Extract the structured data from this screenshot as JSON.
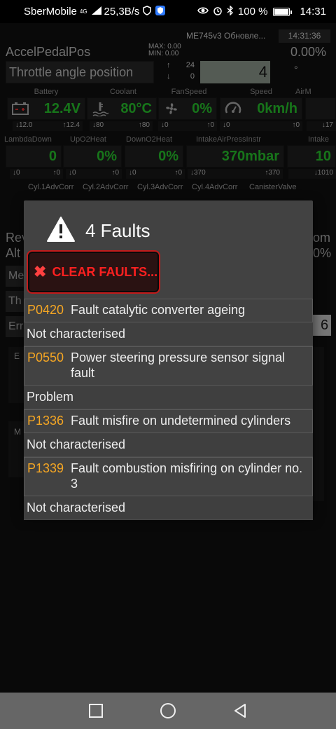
{
  "status_bar": {
    "carrier": "SberMobile",
    "network": "4G",
    "speed": "25,3B/s",
    "battery": "100 %",
    "time": "14:31"
  },
  "app": {
    "title_left": "ME745v3 Обновле...",
    "title_time": "14:31:36",
    "param_name": "AccelPedalPos",
    "max_label": "MAX: 0.00",
    "min_label": "MIN: 0.00",
    "param_value": "0.00%",
    "throttle_label": "Throttle angle position",
    "throttle_up": "24",
    "throttle_down": "0",
    "throttle_value": "4",
    "throttle_unit": "°",
    "throttle_up_arrow": "↑",
    "throttle_down_arrow": "↓"
  },
  "gauges_row1": [
    {
      "label": "Battery",
      "value": "12.4V",
      "icon": "battery-icon",
      "min": "↓12.0",
      "max": "↑12.4"
    },
    {
      "label": "Coolant",
      "value": "80°C",
      "icon": "thermometer-icon",
      "min": "↓80",
      "max": "↑80"
    },
    {
      "label": "FanSpeed",
      "value": "0%",
      "icon": "fan-icon",
      "min": "↓0",
      "max": "↑0"
    },
    {
      "label": "Speed",
      "value": "0km/h",
      "icon": "speedometer-icon",
      "min": "↓0",
      "max": "↑0"
    },
    {
      "label": "AirM",
      "value": "",
      "icon": "",
      "min": "↓17",
      "max": ""
    }
  ],
  "gauges_row2": [
    {
      "label": "LambdaDown",
      "value": "0",
      "min": "↓0",
      "max": "↑0"
    },
    {
      "label": "UpO2Heat",
      "value": "0%",
      "min": "↓0",
      "max": "↑0"
    },
    {
      "label": "DownO2Heat",
      "value": "0%",
      "min": "↓0",
      "max": "↑0"
    },
    {
      "label": "IntakeAirPressInstr",
      "value": "370mbar",
      "min": "↓370",
      "max": "↑370"
    },
    {
      "label": "Intake",
      "value": "10",
      "min": "↓1010",
      "max": ""
    }
  ],
  "gauges_row3": [
    {
      "label": "Cyl.1AdvCorr"
    },
    {
      "label": "Cyl.2AdvCorr"
    },
    {
      "label": "Cyl.3AdvCorr"
    },
    {
      "label": "Cyl.4AdvCorr"
    },
    {
      "label": "CanisterValve"
    }
  ],
  "background_fragments": {
    "rev": "Rev",
    "alt": "Alt",
    "me": "Me",
    "th": "Th",
    "err": "Err",
    "om": "om",
    "pct": "0%",
    "six": "6",
    "e": "E",
    "m": "M"
  },
  "dialog": {
    "title": "4 Faults",
    "clear_button": "CLEAR FAULTS...",
    "faults": [
      {
        "code": "P0420",
        "description": "Fault catalytic converter ageing",
        "status": "Not characterised"
      },
      {
        "code": "P0550",
        "description": "Power steering pressure sensor signal fault",
        "status": "Problem"
      },
      {
        "code": "P1336",
        "description": "Fault misfire on undetermined cylinders",
        "status": "Not characterised"
      },
      {
        "code": "P1339",
        "description": "Fault combustion misfiring on cylinder no. 3",
        "status": "Not characterised"
      }
    ]
  },
  "colors": {
    "value_green": "#2bd630",
    "fault_code_orange": "#f5a623",
    "clear_red": "#ff2020",
    "dialog_bg": "#424242"
  }
}
